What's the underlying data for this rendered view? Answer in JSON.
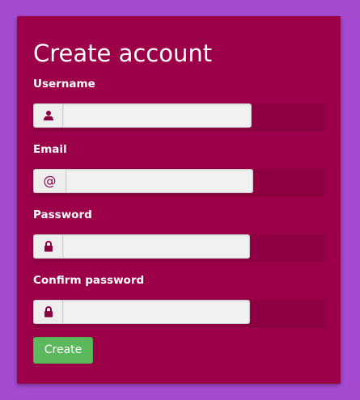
{
  "form": {
    "title": "Create account",
    "fields": [
      {
        "label": "Username",
        "icon": "user-icon",
        "value": "",
        "placeholder": ""
      },
      {
        "label": "Email",
        "icon": "at-icon",
        "icon_glyph": "@",
        "value": "",
        "placeholder": ""
      },
      {
        "label": "Password",
        "icon": "lock-icon",
        "value": "",
        "placeholder": ""
      },
      {
        "label": "Confirm password",
        "icon": "lock-icon",
        "value": "",
        "placeholder": ""
      }
    ],
    "submit_label": "Create"
  },
  "colors": {
    "page_background": "#a64ad1",
    "card_background": "#9b0048",
    "button_background": "#5cb85c",
    "icon_color": "#8a0040"
  }
}
